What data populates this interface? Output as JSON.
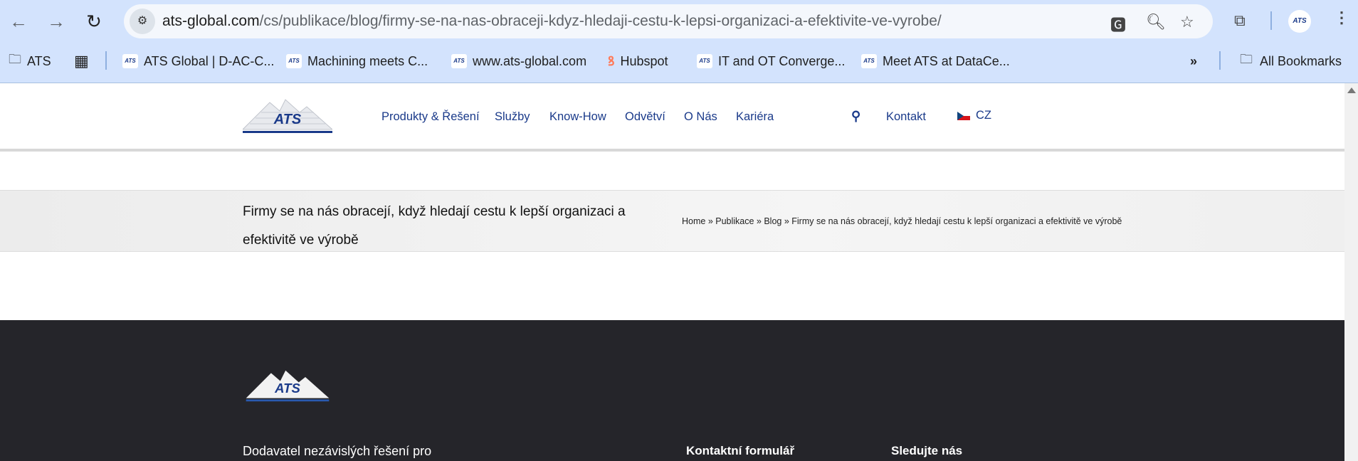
{
  "browser": {
    "url_host": "ats-global.com",
    "url_path": "/cs/publikace/blog/firmy-se-na-nas-obraceji-kdyz-hledaji-cestu-k-lepsi-organizaci-a-efektivite-ve-vyrobe/",
    "bookmarks": [
      {
        "label": "ATS",
        "icon": "folder-gear-icon"
      },
      {
        "label": "ATS Global | D-AC-C...",
        "icon": "ats-favicon"
      },
      {
        "label": "Machining meets C...",
        "icon": "ats-favicon"
      },
      {
        "label": "www.ats-global.com",
        "icon": "ats-favicon"
      },
      {
        "label": "Hubspot",
        "icon": "hubspot-icon"
      },
      {
        "label": "IT and OT Converge...",
        "icon": "ats-favicon"
      },
      {
        "label": "Meet ATS at DataCe...",
        "icon": "ats-favicon"
      }
    ],
    "all_bookmarks": "All Bookmarks",
    "favicon_text": "ATS"
  },
  "header": {
    "logo_text": "ATS",
    "nav": [
      "Produkty & Řešení",
      "Služby",
      "Know-How",
      "Odvětví",
      "O Nás",
      "Kariéra"
    ],
    "contact": "Kontakt",
    "language": "CZ"
  },
  "title_band": {
    "title": "Firmy se na nás obracejí, když hledají cestu k lepší organizaci a efektivitě ve výrobě",
    "breadcrumb": "Home » Publikace » Blog » Firmy se na nás obracejí, když hledají cestu k lepší organizaci a efektivitě ve výrobě"
  },
  "footer": {
    "tagline": "Dodavatel nezávislých řešení pro",
    "contact_form": "Kontaktní formulář",
    "follow": "Sledujte nás"
  }
}
